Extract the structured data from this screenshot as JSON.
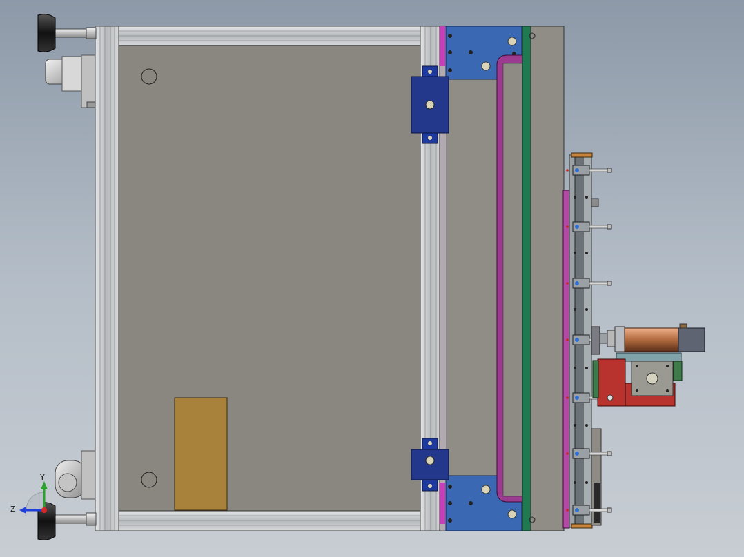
{
  "viewport": {
    "background_top": "#8d99a8",
    "background_bottom": "#c8cdd3"
  },
  "triad": {
    "y_label": "Y",
    "z_label": "Z",
    "y_color": "#2ca02c",
    "z_color": "#1f3fd6",
    "x_color": "#d62728"
  },
  "colors": {
    "panel": "#8a8780",
    "frame": "#c4c7ca",
    "blue_bracket": "#3a68b2",
    "navy_block": "#23388a",
    "magenta_strip": "#9c3a8f",
    "green_strip": "#1f7a52",
    "brown_plate": "#a8813b",
    "motor_copper": "#b06a3e",
    "red_bracket": "#b8322e"
  }
}
